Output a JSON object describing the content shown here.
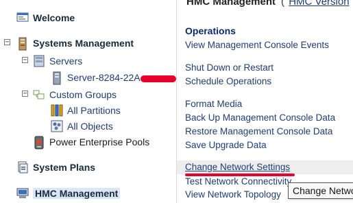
{
  "nav": {
    "welcome": "Welcome",
    "systems_management": "Systems Management",
    "servers": "Servers",
    "server_item": "Server-8284-22A",
    "custom_groups": "Custom Groups",
    "all_partitions": "All Partitions",
    "all_objects": "All Objects",
    "power_enterprise_pools": "Power Enterprise Pools",
    "system_plans": "System Plans",
    "hmc_management": "HMC Management"
  },
  "header": {
    "title": "HMC Management",
    "paren_open": "(",
    "version_link": "HMC Version"
  },
  "main": {
    "operations_heading": "Operations",
    "group1": [
      "View Management Console Events"
    ],
    "group2": [
      "Shut Down or Restart",
      "Schedule Operations"
    ],
    "group3": [
      "Format Media",
      "Back Up Management Console Data",
      "Restore Management Console Data",
      "Save Upgrade Data"
    ],
    "group4": [
      "Change Network Settings",
      "Test Network Connectivity",
      "View Network Topology"
    ]
  },
  "tooltip": {
    "text": "Change Network Settings"
  },
  "colors": {
    "link": "#1f3d73",
    "heading": "#0b2a6b",
    "selected_bg": "#dbe6f5",
    "annotation_red": "#e8002a"
  }
}
